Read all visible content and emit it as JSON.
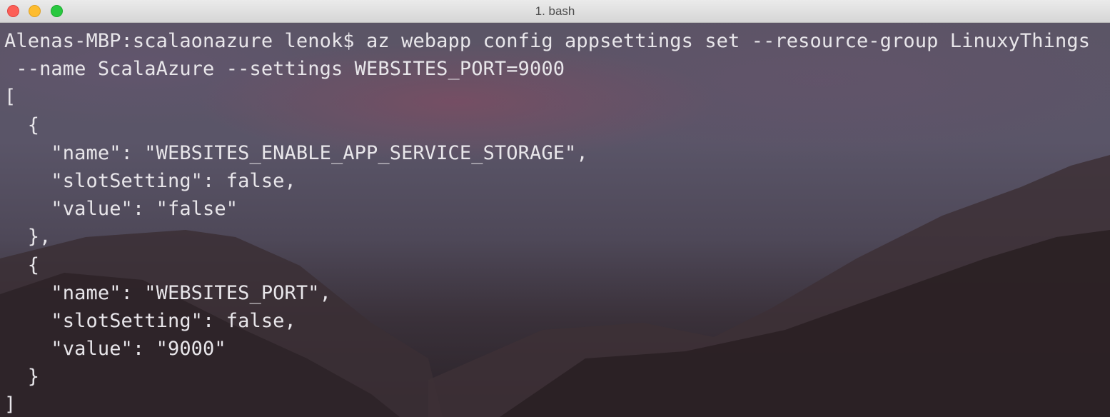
{
  "window": {
    "title": "1. bash",
    "controls": {
      "close": "close-button",
      "minimize": "minimize-button",
      "zoom": "zoom-button"
    }
  },
  "terminal": {
    "lines": [
      "Alenas-MBP:scalaonazure lenok$ az webapp config appsettings set --resource-group LinuxyThings",
      " --name ScalaAzure --settings WEBSITES_PORT=9000",
      "[",
      "  {",
      "    \"name\": \"WEBSITES_ENABLE_APP_SERVICE_STORAGE\",",
      "    \"slotSetting\": false,",
      "    \"value\": \"false\"",
      "  },",
      "  {",
      "    \"name\": \"WEBSITES_PORT\",",
      "    \"slotSetting\": false,",
      "    \"value\": \"9000\"",
      "  }",
      "]"
    ]
  },
  "colors": {
    "text": "#e8e6ea",
    "close": "#fc5f57",
    "minimize": "#fdbc2e",
    "zoom": "#28c840"
  }
}
